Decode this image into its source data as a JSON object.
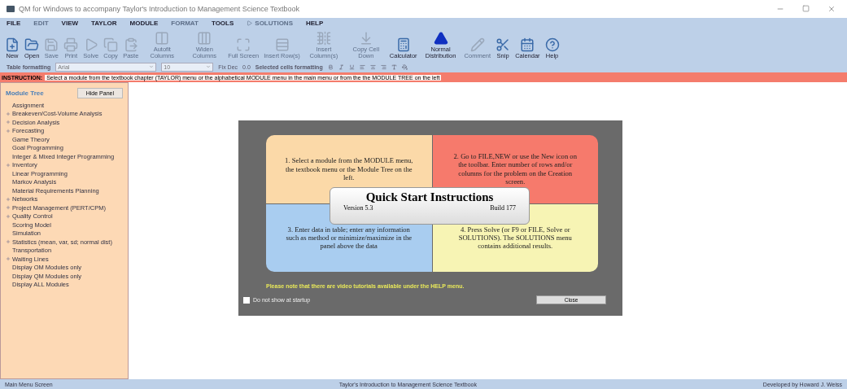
{
  "window": {
    "title": "QM for Windows to accompany Taylor's Introduction to Management Science Textbook"
  },
  "menu": [
    {
      "label": "FILE",
      "disabled": false
    },
    {
      "label": "EDIT",
      "disabled": true
    },
    {
      "label": "VIEW",
      "disabled": false
    },
    {
      "label": "TAYLOR",
      "disabled": false
    },
    {
      "label": "MODULE",
      "disabled": false
    },
    {
      "label": "FORMAT",
      "disabled": true
    },
    {
      "label": "TOOLS",
      "disabled": false
    },
    {
      "label": "SOLUTIONS",
      "disabled": true
    },
    {
      "label": "HELP",
      "disabled": false
    }
  ],
  "toolbar": [
    {
      "label": "New",
      "disabled": false
    },
    {
      "label": "Open",
      "disabled": false
    },
    {
      "label": "Save",
      "disabled": true
    },
    {
      "label": "Print",
      "disabled": true
    },
    {
      "label": "Solve",
      "disabled": true
    },
    {
      "label": "Copy",
      "disabled": true
    },
    {
      "label": "Paste",
      "disabled": true
    },
    {
      "label": "Autofit Columns",
      "disabled": true
    },
    {
      "label": "Widen Columns",
      "disabled": true
    },
    {
      "label": "Full Screen",
      "disabled": true
    },
    {
      "label": "Insert Row(s)",
      "disabled": true
    },
    {
      "label": "Insert Column(s)",
      "disabled": true
    },
    {
      "label": "Copy Cell Down",
      "disabled": true
    },
    {
      "label": "Calculator",
      "disabled": false
    },
    {
      "label": "Normal Distribution",
      "disabled": false
    },
    {
      "label": "Comment",
      "disabled": true
    },
    {
      "label": "Snip",
      "disabled": false
    },
    {
      "label": "Calendar",
      "disabled": false
    },
    {
      "label": "Help",
      "disabled": false
    }
  ],
  "format_bar": {
    "label": "Table formatting",
    "font": "Arial",
    "size": "10",
    "fix_dec": "Fix Dec",
    "decimals": "0.0",
    "selected_label": "Selected cells formatting"
  },
  "instruction": {
    "label": "INSTRUCTION:",
    "text": "Select a module from the textbook chapter (TAYLOR) menu or the alphabetical MODULE menu in the main menu or from the the MODULE TREE on the left"
  },
  "module_tree": {
    "title": "Module Tree",
    "hide_button": "Hide Panel",
    "items": [
      {
        "label": "Assignment",
        "expandable": false
      },
      {
        "label": "Breakeven/Cost-Volume Analysis",
        "expandable": true
      },
      {
        "label": "Decision Analysis",
        "expandable": true
      },
      {
        "label": "Forecasting",
        "expandable": true
      },
      {
        "label": "Game Theory",
        "expandable": false
      },
      {
        "label": "Goal Programming",
        "expandable": false
      },
      {
        "label": "Integer & Mixed Integer Programming",
        "expandable": false
      },
      {
        "label": "Inventory",
        "expandable": true
      },
      {
        "label": "Linear Programming",
        "expandable": false
      },
      {
        "label": "Markov Analysis",
        "expandable": false
      },
      {
        "label": "Material Requirements Planning",
        "expandable": false
      },
      {
        "label": "Networks",
        "expandable": true
      },
      {
        "label": "Project Management (PERT/CPM)",
        "expandable": true
      },
      {
        "label": "Quality Control",
        "expandable": true
      },
      {
        "label": "Scoring Model",
        "expandable": false
      },
      {
        "label": "Simulation",
        "expandable": false
      },
      {
        "label": "Statistics (mean, var, sd; normal dist)",
        "expandable": true
      },
      {
        "label": "Transportation",
        "expandable": false
      },
      {
        "label": "Waiting Lines",
        "expandable": true
      },
      {
        "label": "Display OM Modules only",
        "expandable": false
      },
      {
        "label": "Display QM Modules only",
        "expandable": false
      },
      {
        "label": "Display ALL Modules",
        "expandable": false
      }
    ]
  },
  "dialog": {
    "steps": [
      {
        "text": "1. Select a module from the MODULE menu, the textbook menu or the Module Tree on the left.",
        "color": "#fbd9a8"
      },
      {
        "text": "2. Go to FILE,NEW or use the New icon on the toolbar. Enter number of rows and/or columns for the problem on the Creation screen.",
        "color": "#f67a6c"
      },
      {
        "text": "3. Enter data in table; enter any information such as method or minimize/maximize in the panel above the data",
        "color": "#a9cdf0"
      },
      {
        "text": "4. Press Solve (or F9 or FILE, Solve or SOLUTIONS). The SOLUTIONS menu contains additional results.",
        "color": "#f7f4b4"
      }
    ],
    "title": "Quick Start Instructions",
    "version": "Version 5.3",
    "build": "Build 177",
    "note": "Please note that there are video tutorials available under the HELP menu.",
    "checkbox": {
      "label": "Do not show at startup",
      "checked": false
    },
    "close_button": "Close"
  },
  "status_bar": [
    "Main Menu Screen",
    "Taylor's Introduction to Management Science Textbook",
    "Developed by Howard J. Weiss"
  ]
}
